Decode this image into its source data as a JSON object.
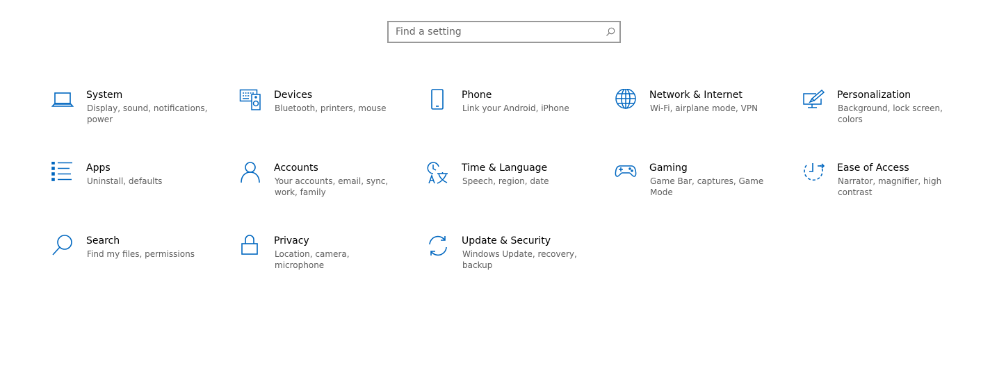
{
  "search": {
    "placeholder": "Find a setting",
    "value": ""
  },
  "accent_color": "#0067c0",
  "categories": [
    {
      "title": "System",
      "description": "Display, sound, notifications, power",
      "icon": "laptop-icon"
    },
    {
      "title": "Devices",
      "description": "Bluetooth, printers, mouse",
      "icon": "keyboard-speaker-icon"
    },
    {
      "title": "Phone",
      "description": "Link your Android, iPhone",
      "icon": "phone-icon"
    },
    {
      "title": "Network & Internet",
      "description": "Wi-Fi, airplane mode, VPN",
      "icon": "globe-icon"
    },
    {
      "title": "Personalization",
      "description": "Background, lock screen, colors",
      "icon": "paint-monitor-icon"
    },
    {
      "title": "Apps",
      "description": "Uninstall, defaults",
      "icon": "apps-list-icon"
    },
    {
      "title": "Accounts",
      "description": "Your accounts, email, sync, work, family",
      "icon": "person-icon"
    },
    {
      "title": "Time & Language",
      "description": "Speech, region, date",
      "icon": "time-language-icon"
    },
    {
      "title": "Gaming",
      "description": "Game Bar, captures, Game Mode",
      "icon": "gamepad-icon"
    },
    {
      "title": "Ease of Access",
      "description": "Narrator, magnifier, high contrast",
      "icon": "ease-of-access-icon"
    },
    {
      "title": "Search",
      "description": "Find my files, permissions",
      "icon": "magnifier-icon"
    },
    {
      "title": "Privacy",
      "description": "Location, camera, microphone",
      "icon": "lock-icon"
    },
    {
      "title": "Update & Security",
      "description": "Windows Update, recovery, backup",
      "icon": "sync-arrows-icon"
    }
  ]
}
